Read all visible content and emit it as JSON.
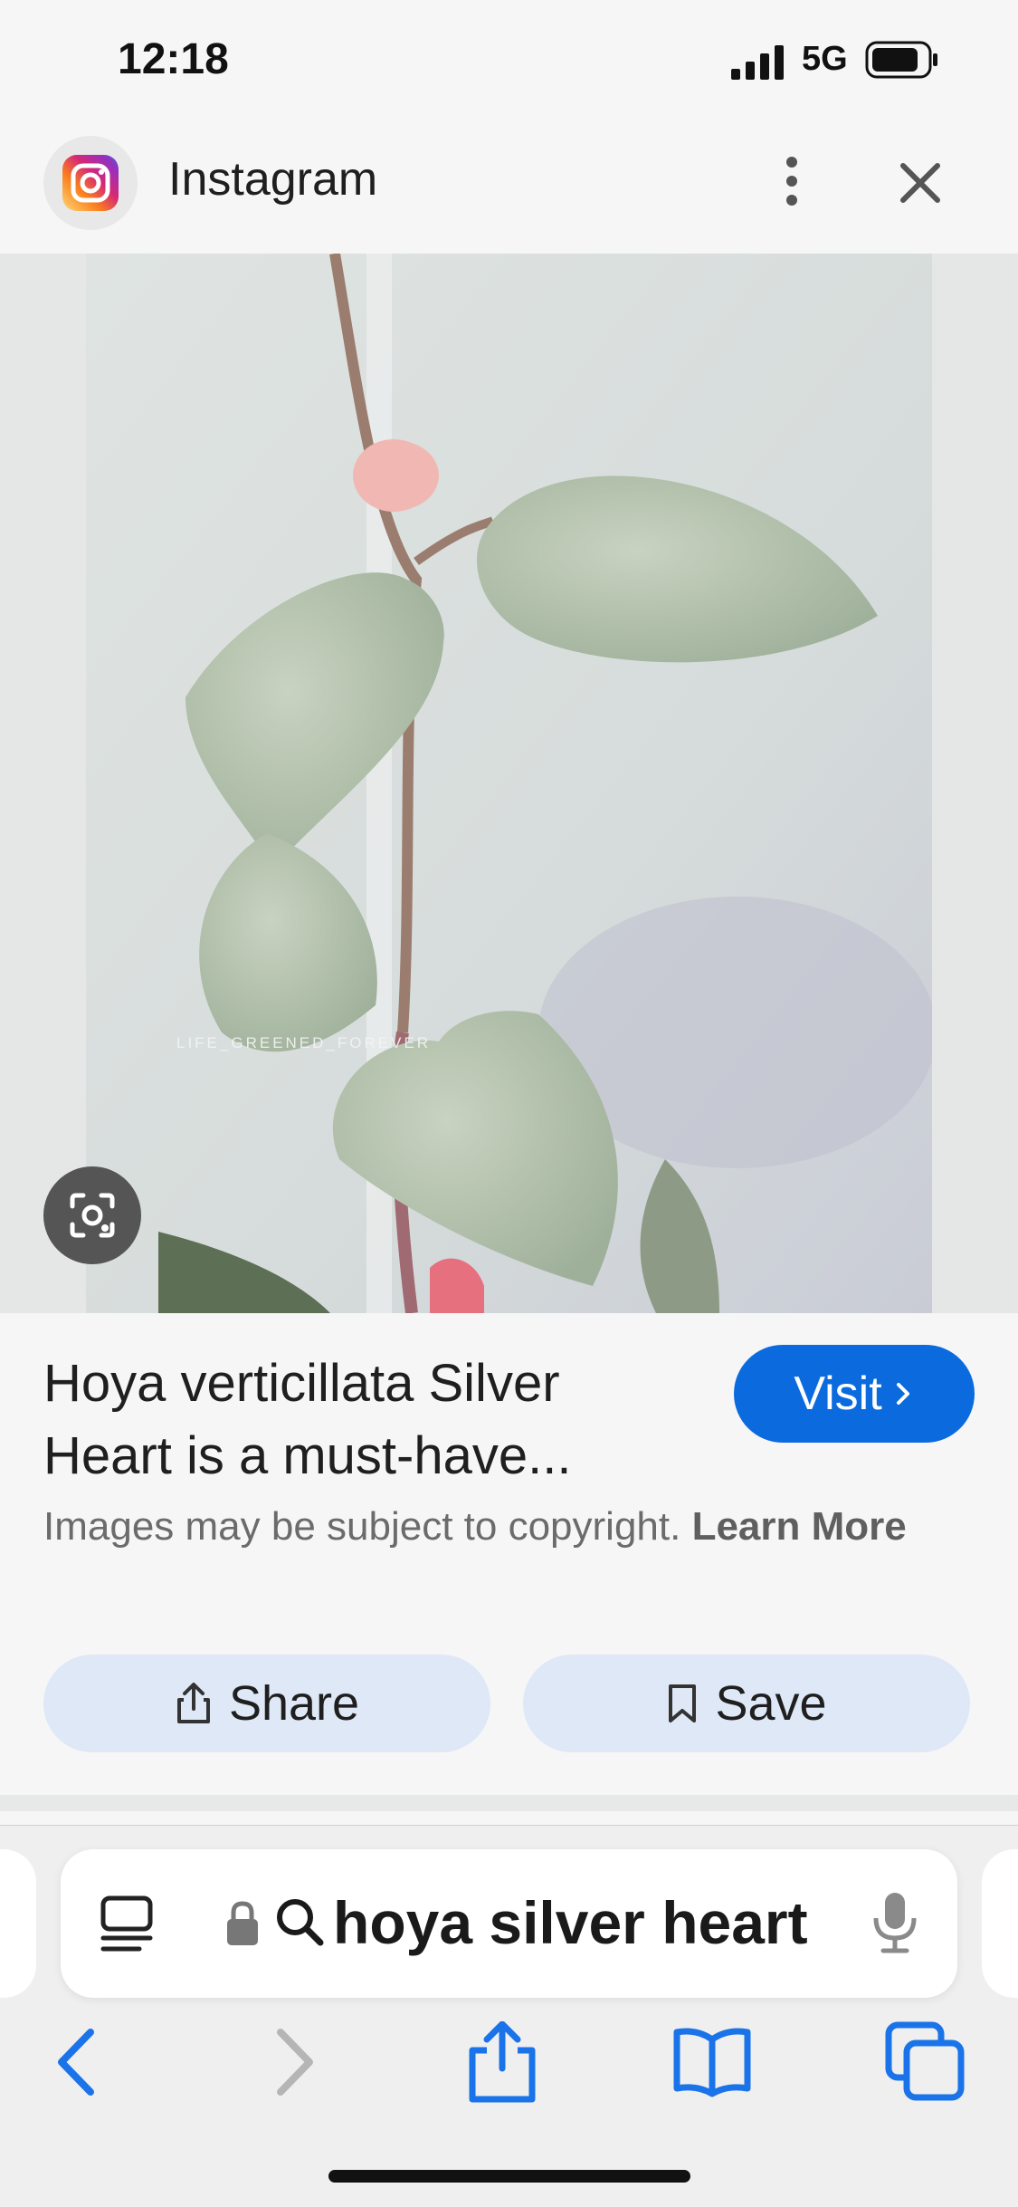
{
  "status_bar": {
    "time": "12:18",
    "network": "5G"
  },
  "header": {
    "title": "Instagram"
  },
  "result": {
    "title_line1": "Hoya verticillata Silver",
    "title_line2": "Heart is a must-have...",
    "visit_label": "Visit",
    "copyright_text": "Images may be subject to copyright.",
    "learn_more": "Learn More",
    "share_label": "Share",
    "save_label": "Save",
    "watermark": "LIFE_GREENED_FOREVER"
  },
  "address_bar": {
    "query": "hoya silver heart"
  },
  "colors": {
    "accent": "#0b6bde",
    "pill_bg": "#dfe8f6",
    "safari_blue": "#1a73e8"
  },
  "icons": [
    "instagram-logo-icon",
    "more-vert-icon",
    "close-icon",
    "lens-icon",
    "chevron-right-icon",
    "share-icon",
    "bookmark-icon",
    "tabs-reader-icon",
    "lock-icon",
    "search-icon",
    "mic-icon",
    "back-icon",
    "forward-icon",
    "share-safari-icon",
    "bookmarks-icon",
    "tabs-icon"
  ]
}
